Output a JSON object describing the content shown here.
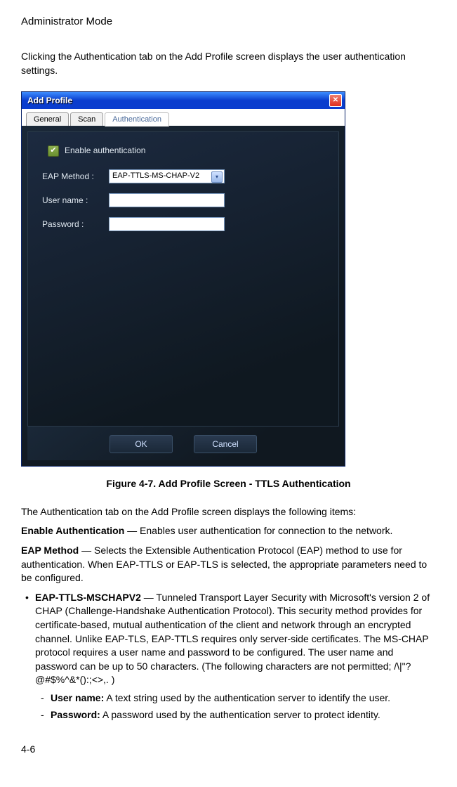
{
  "page": {
    "header": "Administrator Mode",
    "intro": "Clicking the Authentication tab on the Add Profile screen displays the user authentication settings.",
    "figure_caption": "Figure 4-7.  Add Profile Screen - TTLS Authentication",
    "page_number": "4-6"
  },
  "dialog": {
    "title": "Add Profile",
    "tabs": {
      "general": "General",
      "scan": "Scan",
      "auth": "Authentication"
    },
    "enable_label": "Enable authentication",
    "eap_label": "EAP Method :",
    "eap_value": "EAP-TTLS-MS-CHAP-V2",
    "user_label": "User name :",
    "pass_label": "Password :",
    "ok": "OK",
    "cancel": "Cancel"
  },
  "body": {
    "p1": "The Authentication tab on the Add Profile screen displays the following items:",
    "enable_auth_label": "Enable Authentication",
    "enable_auth_text": " — Enables user authentication for connection to the network.",
    "eap_method_label": "EAP Method",
    "eap_method_text": " — Selects the Extensible Authentication Protocol (EAP) method to use for authentication. When EAP-TTLS or EAP-TLS is selected, the appropriate parameters need to be configured.",
    "ttls_label": "EAP-TTLS-MSCHAPV2",
    "ttls_text": " — Tunneled Transport Layer Security with Microsoft's version 2 of CHAP (Challenge-Handshake Authentication Protocol). This security method provides for certificate-based, mutual authentication of the client and network through an encrypted channel. Unlike EAP-TLS, EAP-TTLS requires only server-side certificates. The MS-CHAP protocol requires a user name and password to be configured. The user name and password can be up to 50 characters. (The following characters are not permitted; /\\|\"?@#$%^&*():;<>,. )",
    "user_label": "User name:",
    "user_text": " A text string used by the authentication server to identify the user.",
    "pass_label": "Password:",
    "pass_text": " A password used by the authentication server to protect identity."
  }
}
